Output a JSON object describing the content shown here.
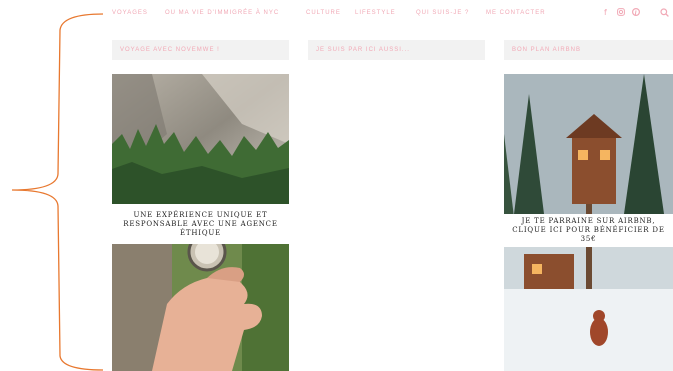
{
  "nav": {
    "items": [
      "Voyages",
      "Ou ma vie d'immigrée à NYC",
      "Culture",
      "Lifestyle",
      "Qui suis-je ?",
      "Me contacter"
    ],
    "social_icons": [
      "facebook-icon",
      "instagram-icon",
      "pinterest-icon"
    ],
    "search_icon": "search-icon"
  },
  "widgets": {
    "left_title": "Voyage avec Novemwe !",
    "middle_title": "Je suis par ici aussi...",
    "right_title": "Bon plan Airbnb"
  },
  "left_card": {
    "caption": "Une expérience unique et responsable avec une agence éthique"
  },
  "right_card": {
    "caption": "Je te parraine sur Airbnb, clique ici pour bénéficier de 35€"
  },
  "colors": {
    "accent": "#f1a9b6",
    "bracket": "#e8782f",
    "header_bg": "#f2f2f2"
  }
}
